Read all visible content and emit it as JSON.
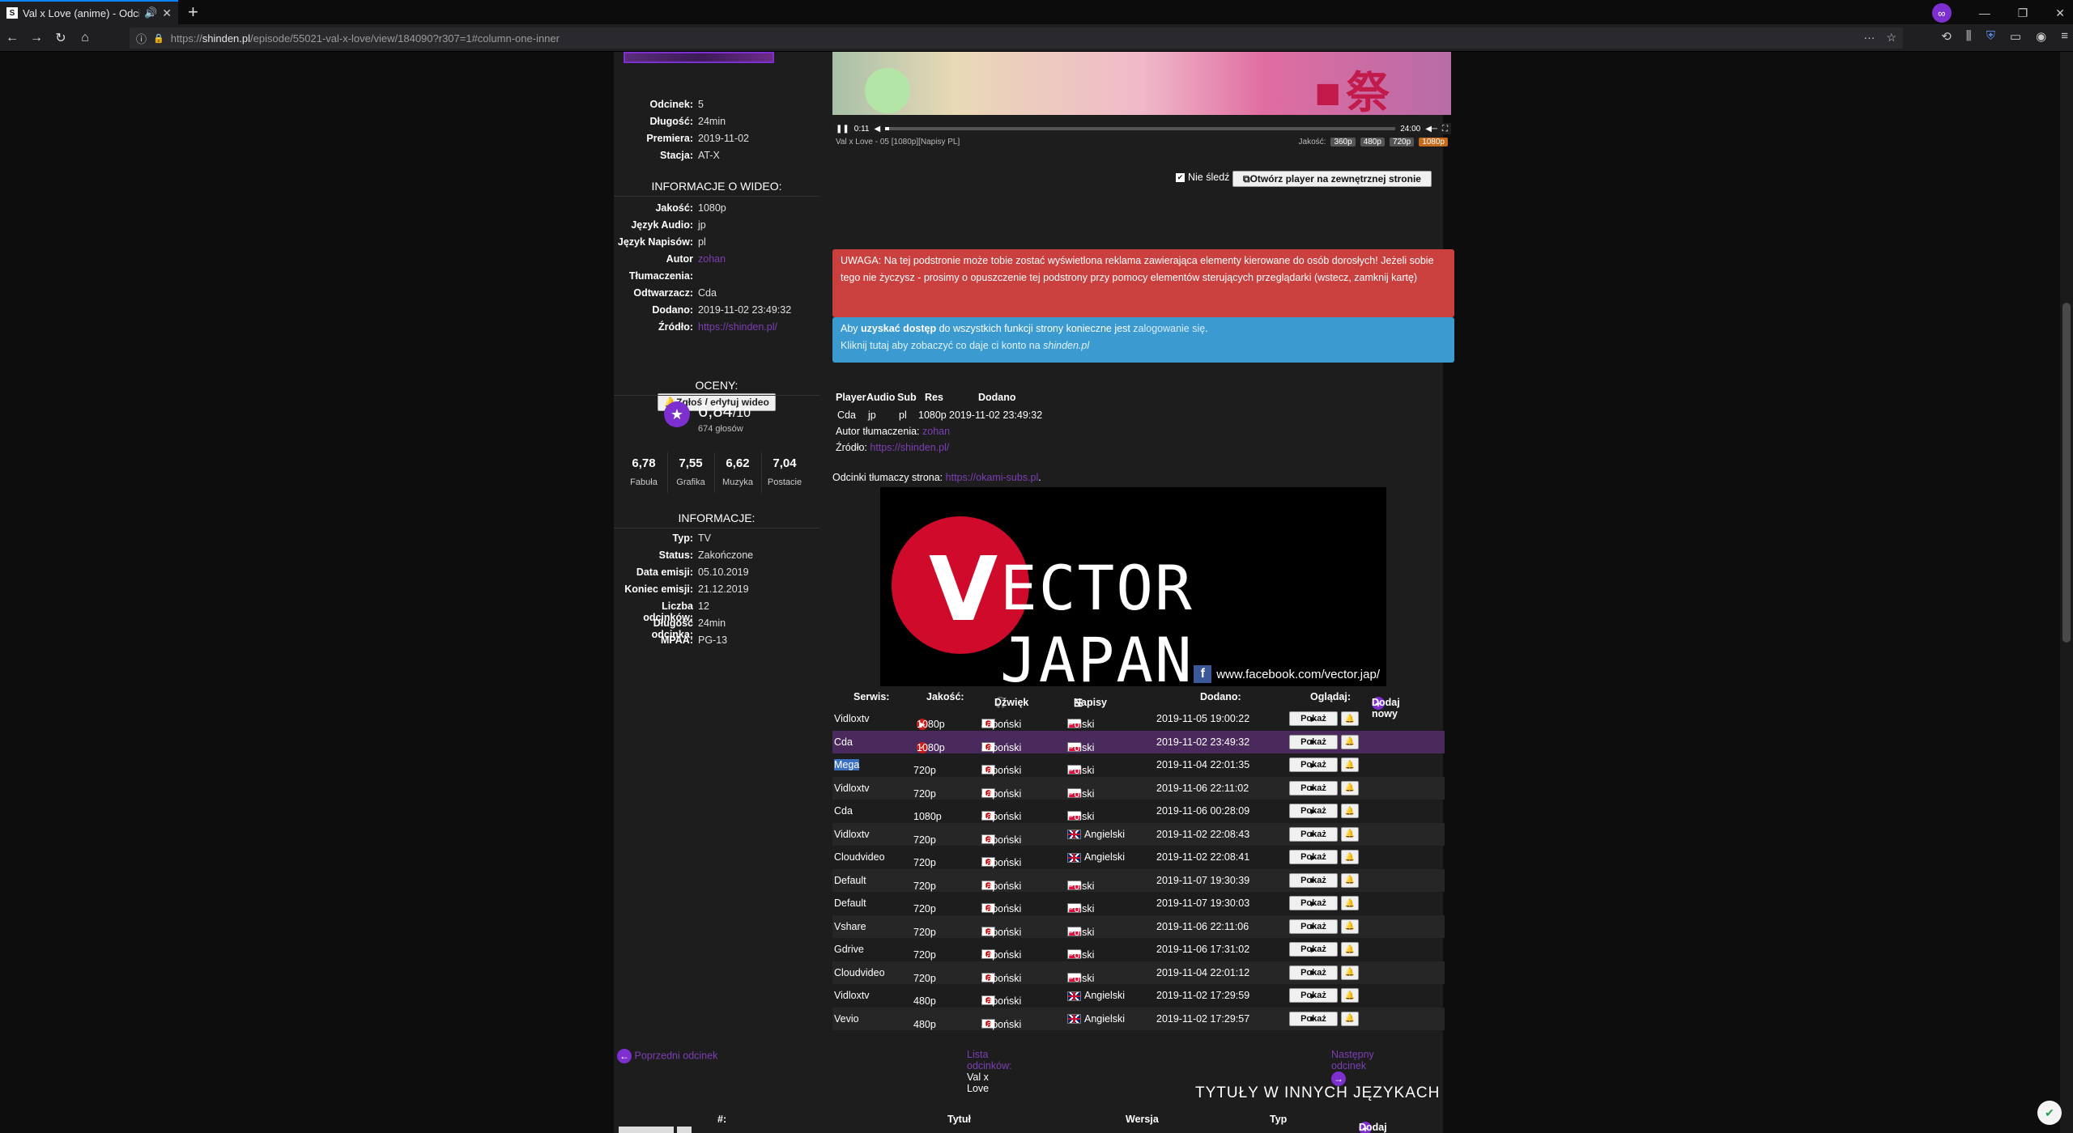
{
  "browser": {
    "tab_title": "Val x Love (anime) - Odcinek",
    "url_prefix": "https://",
    "url_host": "shinden.pl",
    "url_path": "/episode/55021-val-x-love/view/184090?r307=1#column-one-inner"
  },
  "sidebar": {
    "episode_info": [
      {
        "k": "Odcinek:",
        "v": "5"
      },
      {
        "k": "Długość:",
        "v": "24min"
      },
      {
        "k": "Premiera:",
        "v": "2019-11-02"
      },
      {
        "k": "Stacja:",
        "v": "AT-X"
      }
    ],
    "video_info_title": "INFORMACJE O WIDEO:",
    "video_info": [
      {
        "k": "Jakość:",
        "v": "1080p"
      },
      {
        "k": "Język Audio:",
        "v": "jp"
      },
      {
        "k": "Język Napisów:",
        "v": "pl"
      },
      {
        "k": "Autor",
        "v": "zohan"
      },
      {
        "k": "Tłumaczenia:",
        "v": ""
      },
      {
        "k": "Odtwarzacz:",
        "v": "Cda"
      },
      {
        "k": "Dodano:",
        "v": "2019-11-02 23:49:32"
      },
      {
        "k": "Źródło:",
        "v": "https://shinden.pl/"
      }
    ],
    "report_button": "Zgłoś / edytuj wideo",
    "ratings_title": "OCENY:",
    "rating_value": "6,84",
    "rating_max": "/10",
    "votes": "674 głosów",
    "sub_ratings": [
      {
        "n": "6,78",
        "l": "Fabuła"
      },
      {
        "n": "7,55",
        "l": "Grafika"
      },
      {
        "n": "6,62",
        "l": "Muzyka"
      },
      {
        "n": "7,04",
        "l": "Postacie"
      }
    ],
    "info_title": "INFORMACJE:",
    "info": [
      {
        "k": "Typ:",
        "v": "TV"
      },
      {
        "k": "Status:",
        "v": "Zakończone"
      },
      {
        "k": "Data emisji:",
        "v": "05.10.2019"
      },
      {
        "k": "Koniec emisji:",
        "v": "21.12.2019"
      },
      {
        "k": "Liczba odcinków:",
        "v": "12"
      },
      {
        "k": "Długość odcinka:",
        "v": "24min"
      },
      {
        "k": "MPAA:",
        "v": "PG-13"
      }
    ]
  },
  "player": {
    "time_current": "0:11",
    "time_total": "24:00",
    "progress": 0.008,
    "video_title": "Val x Love - 05 [1080p][Napisy PL]",
    "quality_label": "Jakość:",
    "qualities": [
      "360p",
      "480p",
      "720p",
      "1080p"
    ],
    "quality_selected": "1080p",
    "nie_sledz": "Nie śledź",
    "external_button": "Otwórz player na zewnętrznej stronie"
  },
  "alerts": {
    "red_text": "UWAGA: Na tej podstronie może tobie zostać wyświetlona reklama zawierająca elementy kierowane do osób dorosłych! Jeżeli sobie tego nie życzysz - prosimy o opuszczenie tej podstrony przy pomocy elementów sterujących przeglądarki (wstecz, zamknij kartę)",
    "blue_a": "Aby ",
    "blue_b": "uzyskać dostęp",
    "blue_c": " do wszystkich funkcji strony konieczne jest ",
    "blue_link": "zalogowanie się",
    "blue_d": ".",
    "blue_line2a": "Kliknij tutaj aby zobaczyć co daje ci konto na ",
    "blue_line2b": "shinden.pl"
  },
  "player_table": {
    "headers": [
      "Player",
      "Audio",
      "Sub",
      "Res",
      "Dodano"
    ],
    "values": [
      "Cda",
      "jp",
      "pl",
      "1080p",
      "2019-11-02 23:49:32"
    ],
    "author_label": "Autor tłumaczenia:",
    "author": "zohan",
    "source_label": "Źródło:",
    "source": "https://shinden.pl/"
  },
  "translators": {
    "label": "Odcinki tłumaczy strona: ",
    "link": "https://okami-subs.pl",
    "end": "."
  },
  "banner": {
    "letter": "V",
    "text": "ECTOR JAPAN",
    "fb": "www.facebook.com/vector.jap/"
  },
  "episodes": {
    "headers": {
      "serwis": "Serwis:",
      "jakosc": "Jakość:",
      "dzwiek": "Dźwięk",
      "napisy": "Napisy",
      "dodano": "Dodano:",
      "ogladaj": "Oglądaj:",
      "dodaj": "Dodaj nowy"
    },
    "show_label": "Pokaż",
    "rows": [
      {
        "service": "Vidloxtv",
        "quality": "1080p",
        "audio": "Japoński",
        "sub": "Polski",
        "sub_flag": "pl",
        "date": "2019-11-05 19:00:22"
      },
      {
        "service": "Cda",
        "quality": "1080p",
        "audio": "Japoński",
        "sub": "Polski",
        "sub_flag": "pl",
        "date": "2019-11-02 23:49:32"
      },
      {
        "service": "Mega",
        "quality": "720p",
        "audio": "Japoński",
        "sub": "Polski",
        "sub_flag": "pl",
        "date": "2019-11-04 22:01:35"
      },
      {
        "service": "Vidloxtv",
        "quality": "720p",
        "audio": "Japoński",
        "sub": "Polski",
        "sub_flag": "pl",
        "date": "2019-11-06 22:11:02"
      },
      {
        "service": "Cda",
        "quality": "1080p",
        "audio": "Japoński",
        "sub": "Polski",
        "sub_flag": "pl",
        "date": "2019-11-06 00:28:09"
      },
      {
        "service": "Vidloxtv",
        "quality": "720p",
        "audio": "Japoński",
        "sub": "Angielski",
        "sub_flag": "gb",
        "date": "2019-11-02 22:08:43"
      },
      {
        "service": "Cloudvideo",
        "quality": "720p",
        "audio": "Japoński",
        "sub": "Angielski",
        "sub_flag": "gb",
        "date": "2019-11-02 22:08:41"
      },
      {
        "service": "Default",
        "quality": "720p",
        "audio": "Japoński",
        "sub": "Polski",
        "sub_flag": "pl",
        "date": "2019-11-07 19:30:39"
      },
      {
        "service": "Default",
        "quality": "720p",
        "audio": "Japoński",
        "sub": "Polski",
        "sub_flag": "pl",
        "date": "2019-11-07 19:30:03"
      },
      {
        "service": "Vshare",
        "quality": "720p",
        "audio": "Japoński",
        "sub": "Polski",
        "sub_flag": "pl",
        "date": "2019-11-06 22:11:06"
      },
      {
        "service": "Gdrive",
        "quality": "720p",
        "audio": "Japoński",
        "sub": "Polski",
        "sub_flag": "pl",
        "date": "2019-11-06 17:31:02"
      },
      {
        "service": "Cloudvideo",
        "quality": "720p",
        "audio": "Japoński",
        "sub": "Polski",
        "sub_flag": "pl",
        "date": "2019-11-04 22:01:12"
      },
      {
        "service": "Vidloxtv",
        "quality": "480p",
        "audio": "Japoński",
        "sub": "Angielski",
        "sub_flag": "gb",
        "date": "2019-11-02 17:29:59"
      },
      {
        "service": "Vevio",
        "quality": "480p",
        "audio": "Japoński",
        "sub": "Angielski",
        "sub_flag": "gb",
        "date": "2019-11-02 17:29:57"
      }
    ]
  },
  "pager": {
    "prev": "Poprzedni odcinek",
    "list_label": "Lista odcinków:",
    "list_title": "Val x Love",
    "next": "Następny odcinek"
  },
  "other_titles": {
    "title": "TYTUŁY W INNYCH JĘZYKACH",
    "h_num": "#:",
    "h_title": "Tytuł",
    "h_version": "Wersja",
    "h_type": "Typ",
    "h_add": "Dodaj nowy"
  },
  "colors": {
    "accent": "#7d2fd0",
    "alert_red": "#c9403f",
    "alert_blue": "#3b9bd0"
  }
}
